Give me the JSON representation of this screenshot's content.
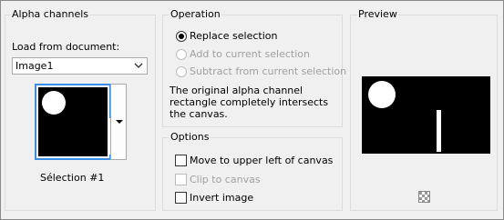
{
  "alpha": {
    "title": "Alpha channels",
    "load_from_label": "Load from document:",
    "document_value": "Image1",
    "selection_name": "Sélection #1"
  },
  "operation": {
    "title": "Operation",
    "options": [
      {
        "label": "Replace selection",
        "selected": true,
        "enabled": true
      },
      {
        "label": "Add to current selection",
        "selected": false,
        "enabled": false
      },
      {
        "label": "Subtract from current selection",
        "selected": false,
        "enabled": false
      }
    ],
    "message": "The original alpha channel rectangle completely intersects the canvas."
  },
  "options": {
    "title": "Options",
    "items": [
      {
        "label": "Move to upper left of canvas",
        "checked": false,
        "enabled": true
      },
      {
        "label": "Clip to canvas",
        "checked": false,
        "enabled": false
      },
      {
        "label": "Invert image",
        "checked": false,
        "enabled": true
      }
    ]
  },
  "preview": {
    "title": "Preview"
  }
}
